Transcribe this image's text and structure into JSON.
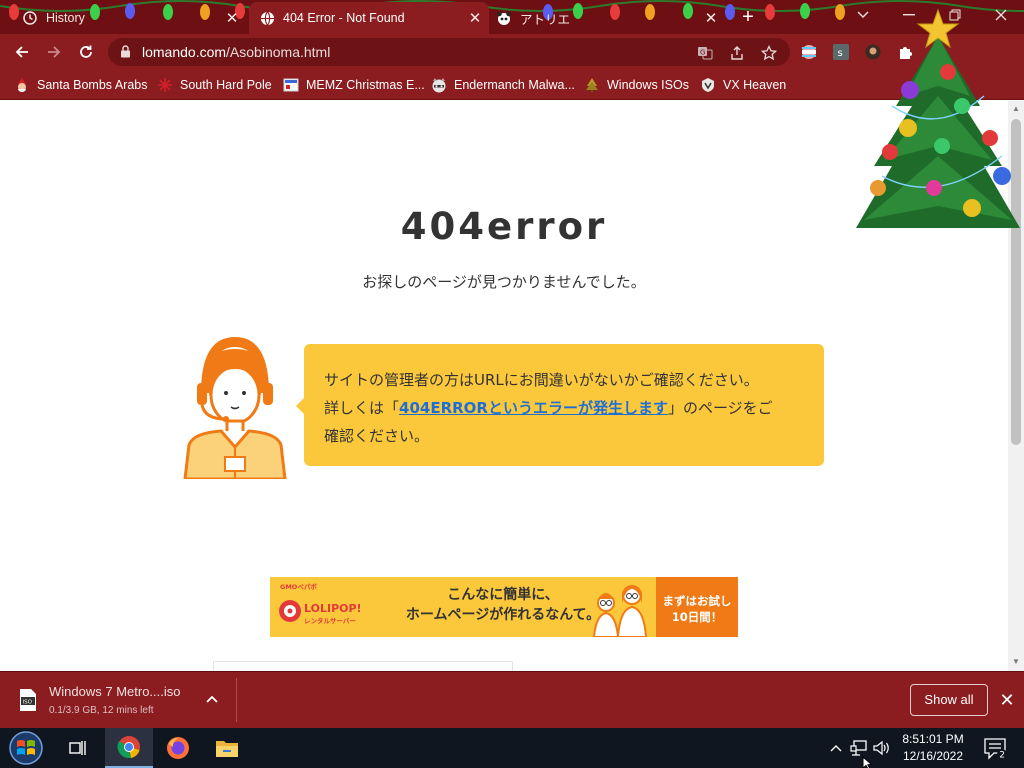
{
  "browser": {
    "tabs": [
      {
        "title": "History",
        "active": false
      },
      {
        "title": "404 Error - Not Found",
        "active": true
      },
      {
        "title": "アトリエ",
        "active": false
      }
    ],
    "url_host": "lomando.com",
    "url_path": "/Asobinoma.html",
    "bookmarks": [
      {
        "label": "Santa Bombs Arabs",
        "icon": "santa-icon"
      },
      {
        "label": "South Hard Pole",
        "icon": "snowflake-icon"
      },
      {
        "label": "MEMZ Christmas E...",
        "icon": "memz-icon"
      },
      {
        "label": "Endermanch Malwa...",
        "icon": "raccoon-icon"
      },
      {
        "label": "Windows ISOs",
        "icon": "tree-icon"
      },
      {
        "label": "VX Heaven",
        "icon": "vx-icon"
      }
    ],
    "colors": {
      "frame": "#6e1013",
      "toolbar": "#8b1c1f"
    }
  },
  "page": {
    "title": "404error",
    "subtitle": "お探しのページが見つかりませんでした。",
    "bubble": {
      "line1": "サイトの管理者の方はURLにお間違いがないかご確認ください。",
      "line2_prefix": "詳しくは「",
      "link": "404ERRORというエラーが発生します",
      "line2_suffix": "」のページをご",
      "line3": "確認ください。"
    },
    "banner": {
      "brand_small": "GMOペパボ",
      "brand": "LOLIPOP!",
      "brand_sub": "レンタルサーバー",
      "message_line1": "こんなに簡単に、",
      "message_line2": "ホームページが作れるなんて。",
      "cta_line1": "まずはお試し",
      "cta_line2": "10日間！"
    },
    "colors": {
      "bubble": "#fcc83b",
      "link": "#1d6fd8",
      "operator": "#f07b16"
    }
  },
  "downloads": {
    "file_name": "Windows 7 Metro....iso",
    "status": "0.1/3.9 GB, 12 mins left",
    "show_all": "Show all"
  },
  "taskbar": {
    "time": "8:51:01 PM",
    "date": "12/16/2022",
    "notification_count": "2",
    "apps": [
      "start-orb",
      "task-view",
      "chrome",
      "firefox",
      "file-explorer"
    ]
  }
}
